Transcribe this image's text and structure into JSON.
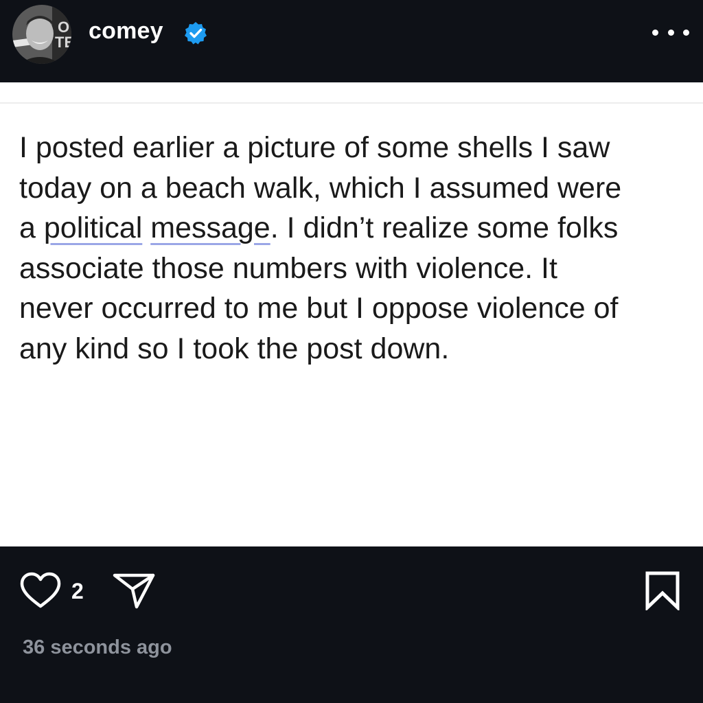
{
  "header": {
    "username": "comey",
    "verified": true,
    "more_icon": "more-horizontal-icon"
  },
  "post": {
    "lines": [
      "I posted earlier a picture of some shells I saw",
      "today on a beach walk, which I assumed were",
      "a ",
      "political",
      " ",
      "message",
      ". I didn’t realize some folks",
      "associate those numbers with violence. It",
      "never occurred to me but I oppose violence of",
      "any kind so I took the post down."
    ]
  },
  "footer": {
    "like_icon": "heart-icon",
    "like_count": "2",
    "share_icon": "send-icon",
    "bookmark_icon": "bookmark-icon",
    "timestamp": "36 seconds ago"
  },
  "colors": {
    "background": "#0e1117",
    "post_background": "#ffffff",
    "verified_blue": "#1d9bf0",
    "timestamp_gray": "#8e939c",
    "spellcheck_underline": "#9aa6e6"
  }
}
